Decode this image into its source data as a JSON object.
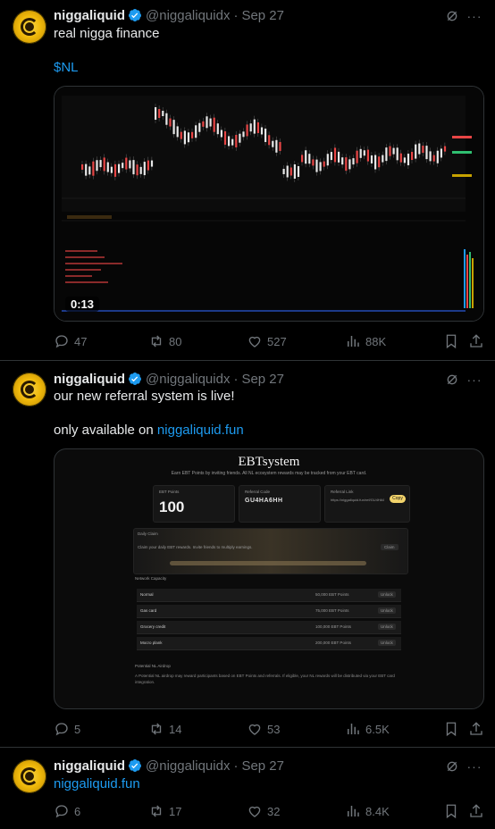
{
  "tweets": [
    {
      "name": "niggaliquid",
      "handle": "@niggaliquidx",
      "dot": "·",
      "date": "Sep 27",
      "line1": "real nigga finance",
      "ticker": "$NL",
      "video_time": "0:13",
      "replies": "47",
      "reposts": "80",
      "likes": "527",
      "views": "88K"
    },
    {
      "name": "niggaliquid",
      "handle": "@niggaliquidx",
      "dot": "·",
      "date": "Sep 27",
      "line1": "our new referral system is live!",
      "line2_prefix": "only available on ",
      "line2_link": "niggaliquid.fun",
      "card": {
        "title": "EBTsystem",
        "subtitle": "Earn EBT Points by inviting friends. All NL ecosystem rewards may be tracked from your EBT card.",
        "points_label": "EBT Points",
        "points_value": "100",
        "code_label": "Referral Code",
        "code_value": "GU4HA6HH",
        "link_label": "Referral Link",
        "link_value": "https://niggaliquid.fun/ref/GU4HA6HH",
        "copy_label": "Copy",
        "daily_claim": "Daily Claim",
        "daily_text": "Claim your daily EBT rewards. Invite friends to multiply earnings.",
        "claim_label": "Claim",
        "network_label": "Network Capacity",
        "rows": [
          {
            "label": "Normal",
            "value": "50,000 EBT Points",
            "btn": "Unlock"
          },
          {
            "label": "Gas card",
            "value": "75,000 EBT Points",
            "btn": "Unlock"
          },
          {
            "label": "Grocery credit",
            "value": "100,000 EBT Points",
            "btn": "Unlock"
          },
          {
            "label": "Mocro plank",
            "value": "200,000 EBT Points",
            "btn": "Unlock"
          }
        ],
        "footer_title": "Potential NL Airdrop",
        "footer_text": "A Potential NL airdrop may reward participants based on EBT Points and referrals. If eligible, your NL rewards will be distributed via your EBT card integration."
      },
      "replies": "5",
      "reposts": "14",
      "likes": "53",
      "views": "6.5K"
    },
    {
      "name": "niggaliquid",
      "handle": "@niggaliquidx",
      "dot": "·",
      "date": "Sep 27",
      "link": "niggaliquid.fun",
      "replies": "6",
      "reposts": "17",
      "likes": "32",
      "views": "8.4K"
    }
  ],
  "colors": {
    "background": "#000000",
    "text": "#e7e9ea",
    "muted": "#71767b",
    "link": "#1d9bf0",
    "divider": "#2f3336",
    "verified": "#1d9bf0",
    "avatar": "#f0b90b"
  },
  "icons": [
    "verified-badge-icon",
    "grok-icon",
    "more-icon",
    "reply-icon",
    "repost-icon",
    "like-icon",
    "views-icon",
    "bookmark-icon",
    "share-icon"
  ]
}
